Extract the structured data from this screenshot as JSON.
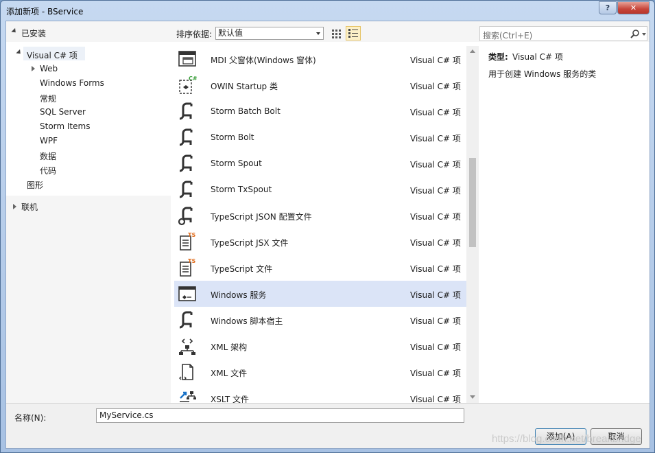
{
  "window": {
    "title": "添加新项 - BService",
    "help_label": "?",
    "close_label": "✕"
  },
  "left": {
    "installed_label": "已安装",
    "tree": [
      {
        "label": "Visual C# 项"
      },
      {
        "label": "Web"
      },
      {
        "label": "Windows Forms"
      },
      {
        "label": "常规"
      },
      {
        "label": "SQL Server"
      },
      {
        "label": "Storm Items"
      },
      {
        "label": "WPF"
      },
      {
        "label": "数据"
      },
      {
        "label": "代码"
      },
      {
        "label": "图形"
      }
    ],
    "online_label": "联机"
  },
  "toolbar": {
    "sort_label": "排序依据:",
    "sort_value": "默认值"
  },
  "search": {
    "placeholder": "搜索(Ctrl+E)",
    "icon": "search-icon"
  },
  "items": [
    {
      "name": "MDI 父窗体(Windows 窗体)",
      "type": "Visual C# 项",
      "icon": "mdi-form-icon"
    },
    {
      "name": "OWIN Startup 类",
      "type": "Visual C# 项",
      "icon": "owin-class-icon",
      "badge": "C#"
    },
    {
      "name": "Storm Batch Bolt",
      "type": "Visual C# 项",
      "icon": "storm-icon"
    },
    {
      "name": "Storm Bolt",
      "type": "Visual C# 项",
      "icon": "storm-icon"
    },
    {
      "name": "Storm Spout",
      "type": "Visual C# 项",
      "icon": "storm-icon"
    },
    {
      "name": "Storm TxSpout",
      "type": "Visual C# 项",
      "icon": "storm-icon"
    },
    {
      "name": "TypeScript JSON 配置文件",
      "type": "Visual C# 项",
      "icon": "json-config-icon"
    },
    {
      "name": "TypeScript JSX 文件",
      "type": "Visual C# 项",
      "icon": "typescript-file-icon",
      "badge": "TS"
    },
    {
      "name": "TypeScript 文件",
      "type": "Visual C# 项",
      "icon": "typescript-file-icon",
      "badge": "TS"
    },
    {
      "name": "Windows 服务",
      "type": "Visual C# 项",
      "icon": "windows-service-icon",
      "selected": true
    },
    {
      "name": "Windows 脚本宿主",
      "type": "Visual C# 项",
      "icon": "storm-icon"
    },
    {
      "name": "XML 架构",
      "type": "Visual C# 项",
      "icon": "xml-schema-icon"
    },
    {
      "name": "XML 文件",
      "type": "Visual C# 项",
      "icon": "xml-file-icon"
    },
    {
      "name": "XSLT 文件",
      "type": "Visual C# 项",
      "icon": "xslt-file-icon"
    }
  ],
  "details": {
    "type_label": "类型:",
    "type_value": "Visual C# 项",
    "description": "用于创建 Windows 服务的类"
  },
  "bottom": {
    "name_label": "名称(N):",
    "name_value": "MyService.cs",
    "add_label": "添加(A)",
    "cancel_label": "取消"
  },
  "watermark": "https://blog.csdn.net/breakbridge",
  "colors": {
    "selection": "#dbe4f7",
    "title_bg": "#b9cfea",
    "close_button": "#c7453a",
    "badge_csharp": "#3a9e3a",
    "badge_ts": "#e06b1a"
  }
}
